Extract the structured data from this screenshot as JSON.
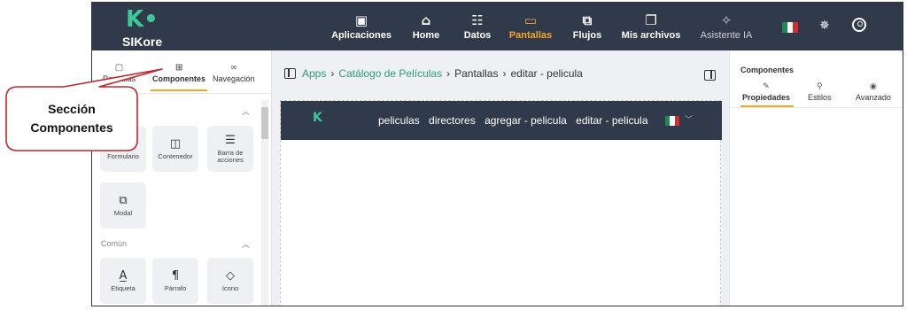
{
  "topbar": {
    "brand": "SIKore",
    "nav": [
      {
        "label": "Aplicaciones",
        "icon": "apps-icon",
        "glyph": "▣"
      },
      {
        "label": "Home",
        "icon": "home-icon",
        "glyph": "⌂"
      },
      {
        "label": "Datos",
        "icon": "database-icon",
        "glyph": "☷"
      },
      {
        "label": "Pantallas",
        "icon": "screen-icon",
        "glyph": "▭"
      },
      {
        "label": "Flujos",
        "icon": "flow-icon",
        "glyph": "⧉"
      },
      {
        "label": "Mis archivos",
        "icon": "files-icon",
        "glyph": "❐"
      },
      {
        "label": "Asistente IA",
        "icon": "sparkle-icon",
        "glyph": "✧"
      }
    ],
    "active_nav": "Pantallas",
    "accent_color": "#f5a623"
  },
  "left_panel": {
    "tabs": [
      {
        "label": "Pantallas",
        "icon": "file-icon"
      },
      {
        "label": "Componentes",
        "icon": "components-icon"
      },
      {
        "label": "Navegación",
        "icon": "link-icon"
      }
    ],
    "active_tab": "Componentes",
    "group1_tiles": [
      {
        "label": "Formulario",
        "icon": "form-icon"
      },
      {
        "label": "Contenedor",
        "icon": "container-icon"
      },
      {
        "label": "Barra de acciones",
        "icon": "action-bar-icon"
      },
      {
        "label": "Modal",
        "icon": "modal-icon"
      }
    ],
    "section_comun": "Común",
    "group2_tiles": [
      {
        "label": "Etiqueta",
        "icon": "label-icon"
      },
      {
        "label": "Párrafo",
        "icon": "paragraph-icon"
      },
      {
        "label": "Icono",
        "icon": "shapes-icon"
      }
    ]
  },
  "breadcrumb": {
    "items": [
      "Apps",
      "Catálogo de Películas",
      "Pantallas",
      "editar - pelicula"
    ]
  },
  "preview": {
    "links": [
      "peliculas",
      "directores",
      "agregar - pelicula",
      "editar - pelicula"
    ]
  },
  "right_panel": {
    "title": "Componentes",
    "tabs": [
      {
        "label": "Propiedades",
        "icon": "pencil-icon"
      },
      {
        "label": "Estilos",
        "icon": "paint-icon"
      },
      {
        "label": "Avanzado",
        "icon": "eye-icon"
      }
    ],
    "active_tab": "Propiedades"
  },
  "callout": {
    "line1": "Sección",
    "line2": "Componentes"
  }
}
